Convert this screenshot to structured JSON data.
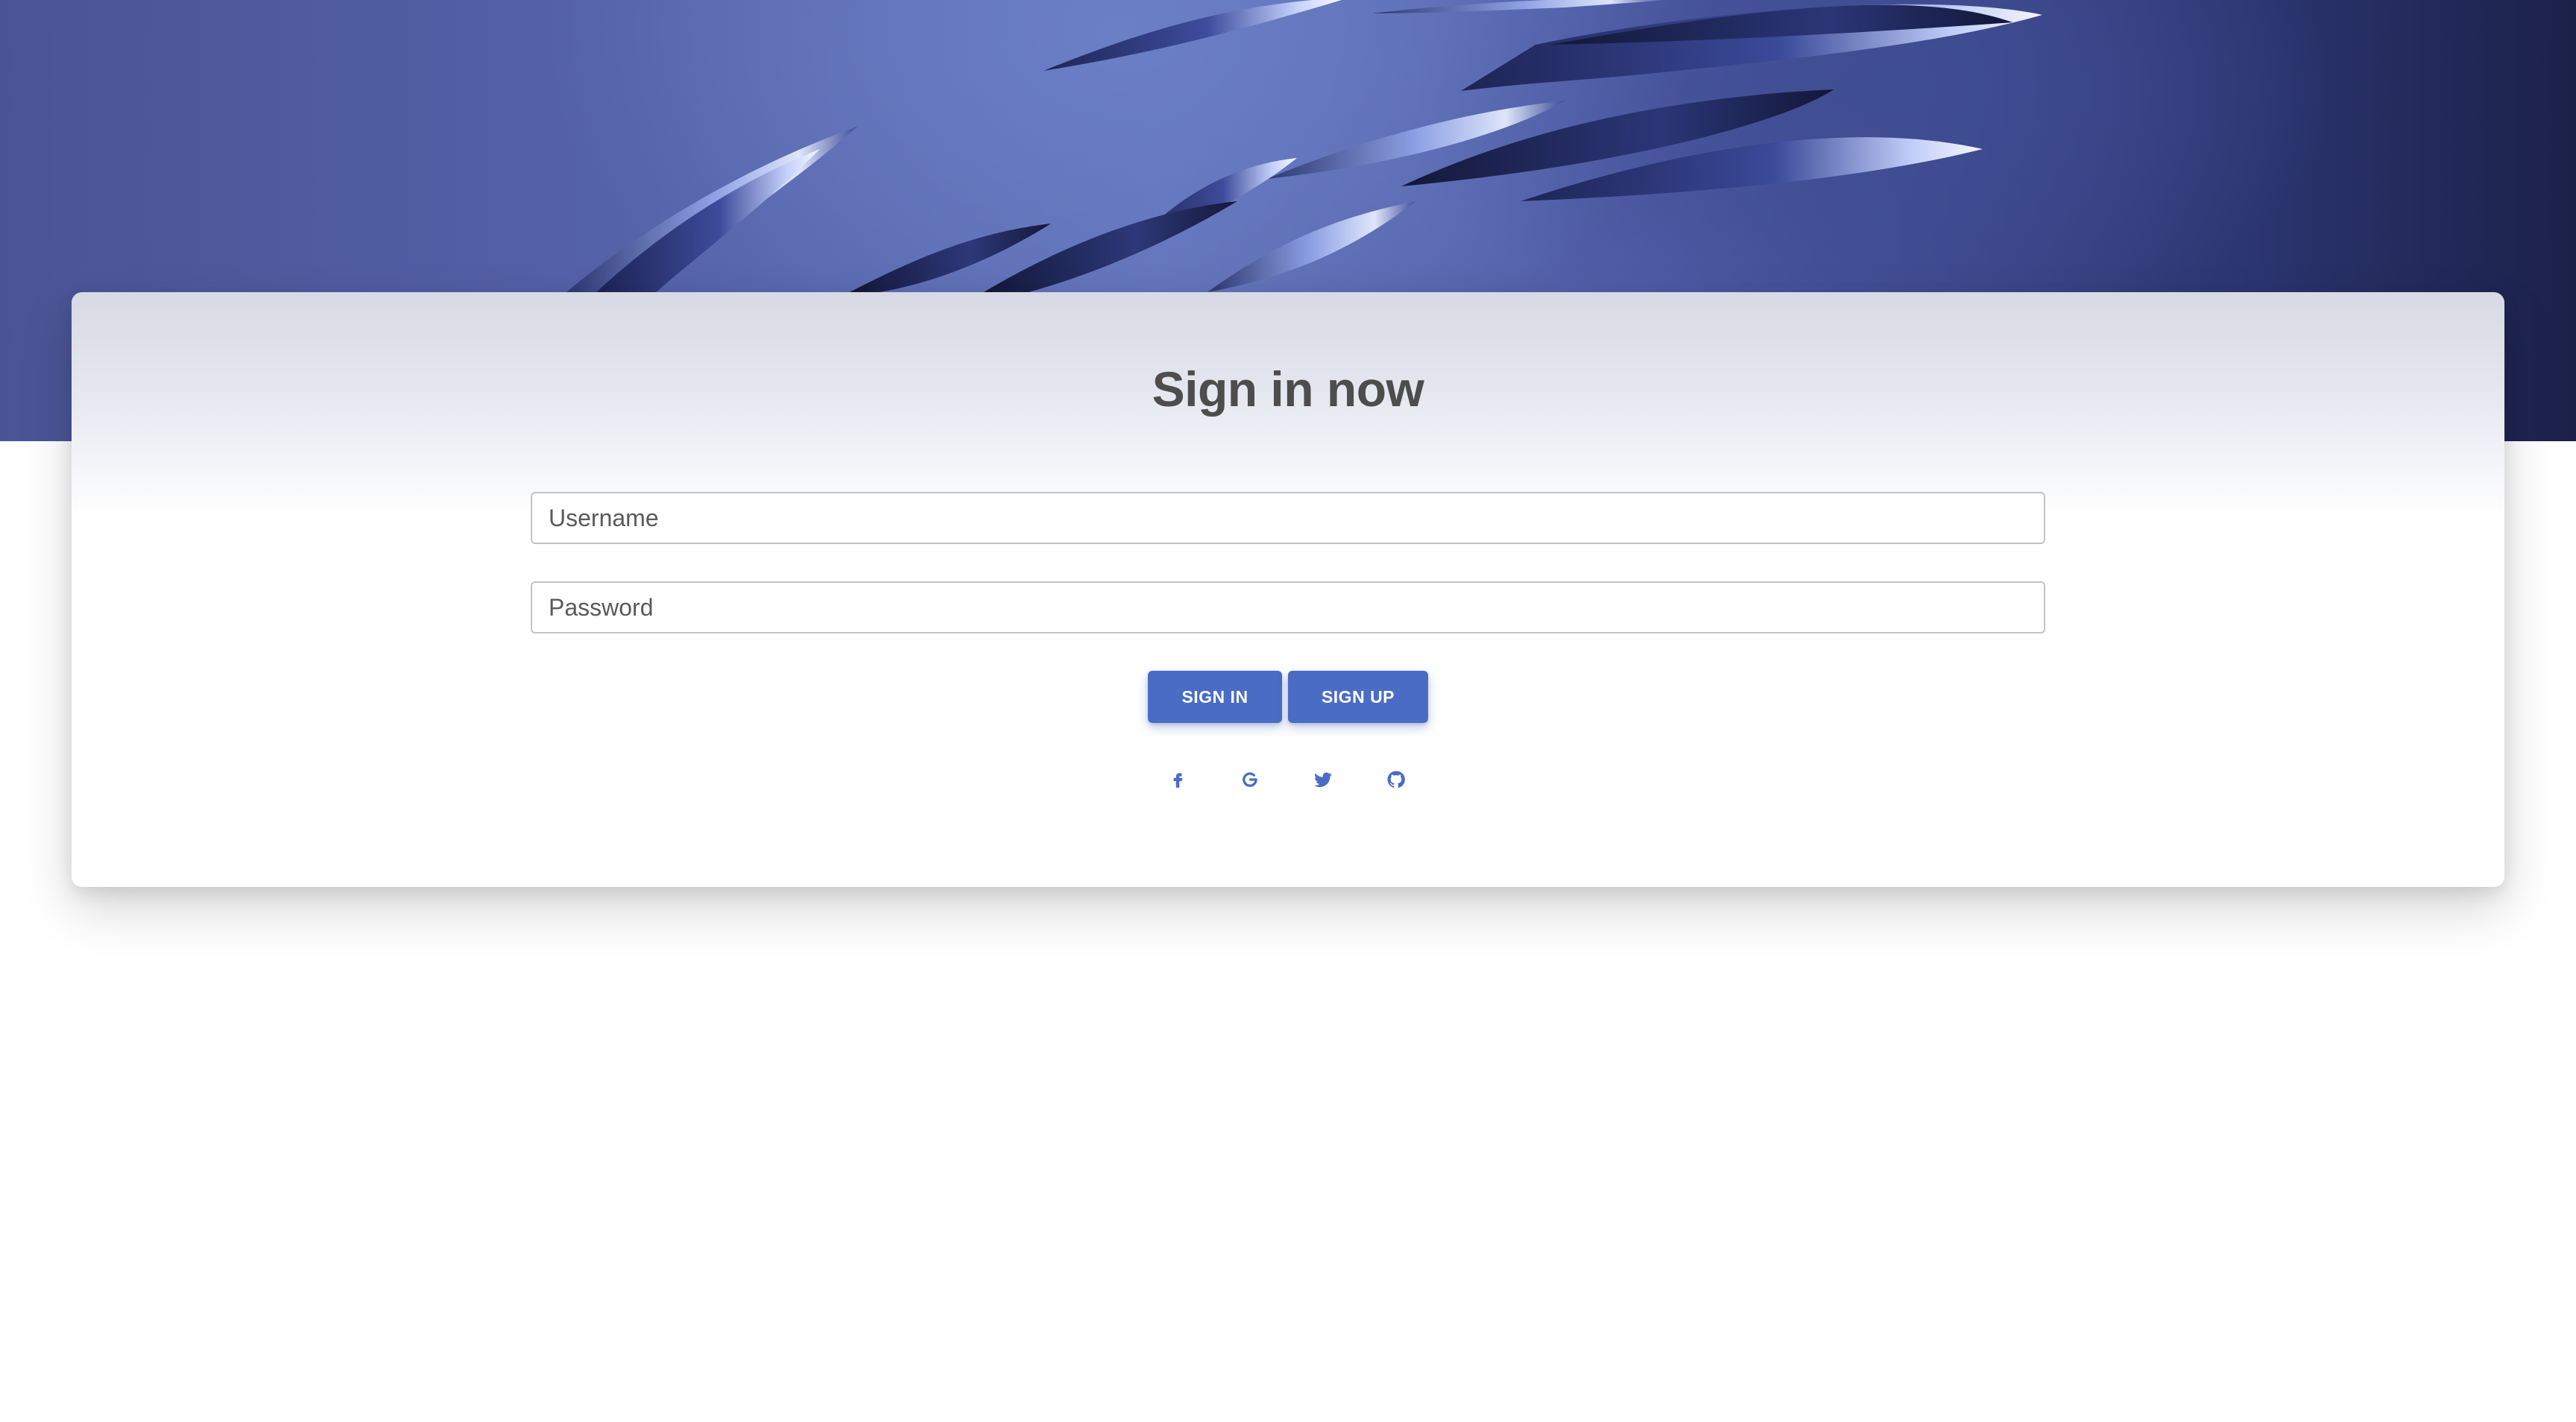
{
  "form": {
    "title": "Sign in now",
    "username_placeholder": "Username",
    "password_placeholder": "Password",
    "sign_in_label": "SIGN IN",
    "sign_up_label": "SIGN UP"
  },
  "social_icons": [
    "facebook-icon",
    "google-icon",
    "twitter-icon",
    "github-icon"
  ],
  "colors": {
    "accent": "#4a6cc4",
    "title_text": "#4d4d4d",
    "hero_base": "#5563a9",
    "hero_dark": "#1b2149"
  }
}
